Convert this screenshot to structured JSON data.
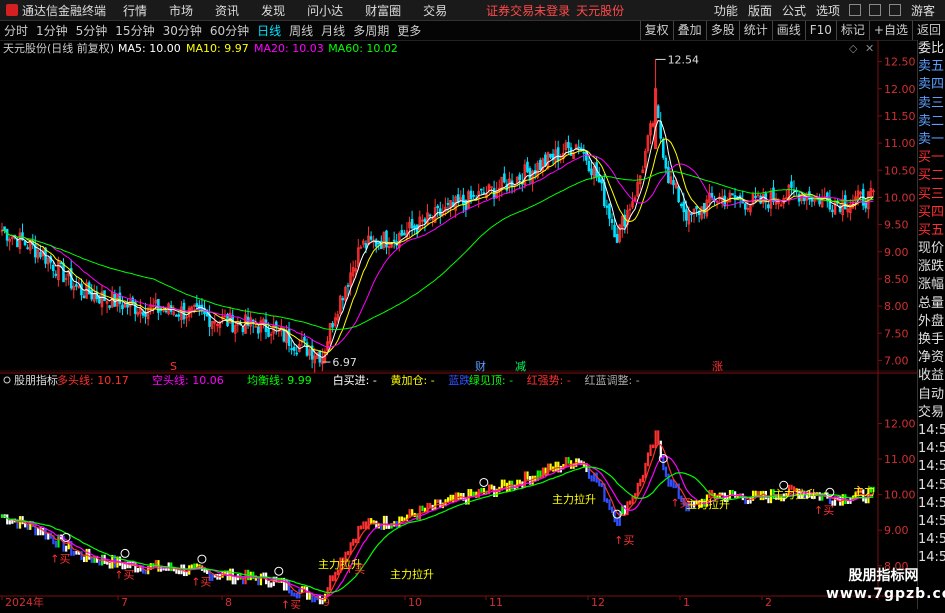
{
  "app": {
    "title": "通达信金融终端"
  },
  "menu": [
    "行情",
    "市场",
    "资讯",
    "发现",
    "问小达",
    "财富圈",
    "交易"
  ],
  "warning": {
    "text": "证券交易未登录",
    "stock": "天元股份"
  },
  "right_menu": [
    "功能",
    "版面",
    "公式",
    "选项"
  ],
  "user": "游客",
  "periods": [
    "分时",
    "1分钟",
    "5分钟",
    "15分钟",
    "30分钟",
    "60分钟",
    "日线",
    "周线",
    "月线",
    "多周期",
    "更多"
  ],
  "active_period": "日线",
  "toolbar": [
    "复权",
    "叠加",
    "多股",
    "统计",
    "画线",
    "F10",
    "标记",
    "+自选",
    "返回"
  ],
  "main_chart": {
    "header": "天元股份(日线 前复权)",
    "ma_labels": [
      {
        "text": "MA5: 10.00",
        "color": "#ffffff"
      },
      {
        "text": "MA10: 9.97",
        "color": "#ffff00"
      },
      {
        "text": "MA20: 10.03",
        "color": "#ff00ff"
      },
      {
        "text": "MA60: 10.02",
        "color": "#00ff00"
      }
    ],
    "high_label": "12.54",
    "low_label": "6.97",
    "y_ticks": [
      "12.50",
      "12.00",
      "11.50",
      "11.00",
      "10.50",
      "10.00",
      "9.50",
      "9.00",
      "8.50",
      "8.00",
      "7.50",
      "7.00"
    ],
    "event_marks": [
      {
        "text": "S",
        "color": "#ff3030"
      },
      {
        "text": "财",
        "color": "#5aa0ff"
      },
      {
        "text": "减",
        "color": "#00ff60"
      },
      {
        "text": "涨",
        "color": "#ff3030"
      }
    ]
  },
  "sub_chart": {
    "header_name": "股朋指标",
    "labels": [
      {
        "text": "多头线: 10.17",
        "color": "#ff3030"
      },
      {
        "text": "空头线: 10.06",
        "color": "#ff00ff"
      },
      {
        "text": "均衡线: 9.99",
        "color": "#00ff00"
      },
      {
        "text": "白买进: -",
        "color": "#ffffff"
      },
      {
        "text": "黄加仓: -",
        "color": "#ffff00"
      },
      {
        "text": "蓝跌",
        "color": "#3050ff"
      },
      {
        "text": "绿见顶: -",
        "color": "#00ff00"
      },
      {
        "text": "红强势: -",
        "color": "#ff3030"
      },
      {
        "text": "红蓝调整: -",
        "color": "#aaaaaa"
      }
    ],
    "y_ticks": [
      "12.00",
      "11.00",
      "10.00",
      "9.00",
      "8.00"
    ],
    "signal_labels": [
      "主力拉升",
      "主力拉升",
      "主力拉升",
      "主力拉升",
      "主力拉升",
      "主力"
    ],
    "buy_label": "买"
  },
  "x_labels": [
    "2024年",
    "7",
    "8",
    "9",
    "10",
    "11",
    "12",
    "1",
    "2"
  ],
  "sidebar": [
    "委比",
    "卖五",
    "卖四",
    "卖三",
    "卖二",
    "卖一",
    "买一",
    "买二",
    "买三",
    "买四",
    "买五",
    "现价",
    "涨跌",
    "涨幅",
    "总量",
    "外盘",
    "换手",
    "净资",
    "收益",
    "自动",
    "交易",
    "14:56",
    "14:56",
    "14:56",
    "14:56",
    "14:56",
    "14:56",
    "14:56",
    "14:56"
  ],
  "watermark": {
    "line1": "股朋指标网",
    "line2": "www.7gpzb.com"
  }
}
